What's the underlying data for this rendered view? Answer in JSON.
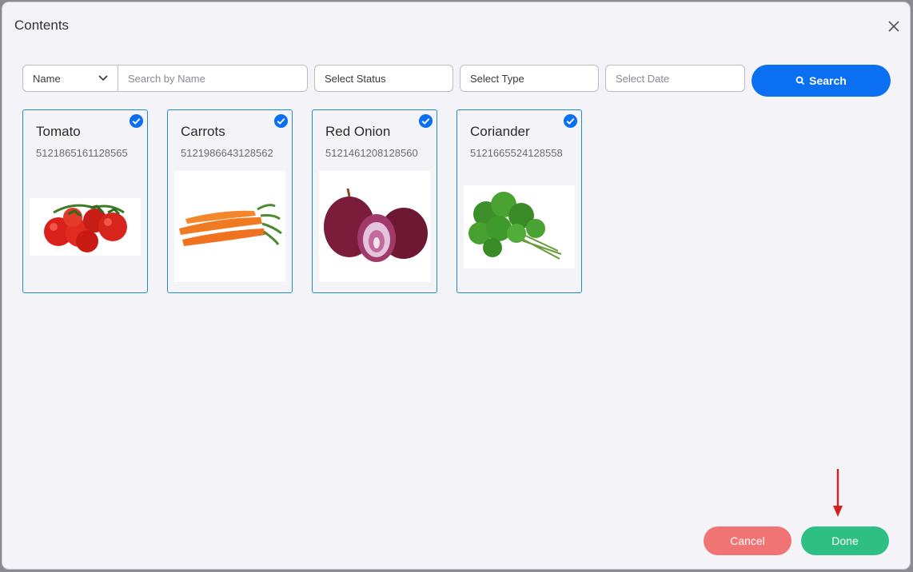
{
  "dialog": {
    "title": "Contents"
  },
  "filters": {
    "name_select": "Name",
    "search_placeholder": "Search by Name",
    "status": "Select Status",
    "type": "Select Type",
    "date": "Select Date",
    "search_button": "Search"
  },
  "items": [
    {
      "name": "Tomato",
      "id": "5121865161128565",
      "selected": true,
      "image": "tomato-image"
    },
    {
      "name": "Carrots",
      "id": "5121986643128562",
      "selected": true,
      "image": "carrots-image"
    },
    {
      "name": "Red Onion",
      "id": "5121461208128560",
      "selected": true,
      "image": "red-onion-image"
    },
    {
      "name": "Coriander",
      "id": "5121665524128558",
      "selected": true,
      "image": "coriander-image"
    }
  ],
  "footer": {
    "cancel": "Cancel",
    "done": "Done"
  },
  "colors": {
    "primary": "#0a6ff0",
    "card_border": "#1d8cd6",
    "cancel": "#f07474",
    "done": "#2ebf84",
    "annotation_arrow": "#d61f1f"
  }
}
